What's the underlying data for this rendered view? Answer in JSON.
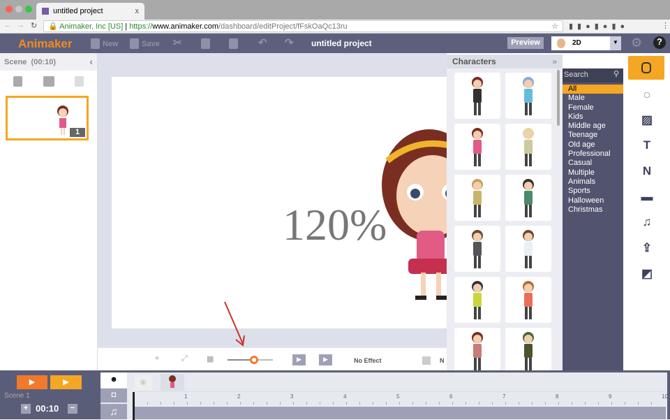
{
  "browser": {
    "tab_title": "untitled project",
    "tab_close": "x",
    "secure_label": "Animaker, Inc [US]",
    "url_prefix": "https://",
    "url_host": "www.animaker.com",
    "url_path": "/dashboard/editProject/fFskOaQc13ru"
  },
  "header": {
    "logo": "Animaker",
    "new_label": "New",
    "save_label": "Save",
    "project_title": "untitled project",
    "preview_label": "Preview",
    "mode_select": "2D"
  },
  "scene_panel": {
    "title": "Scene",
    "duration": "(00:10)",
    "scene_number": "1"
  },
  "canvas": {
    "zoom_overlay": "120%",
    "effect_label": "No Effect",
    "effect2_label": "N"
  },
  "characters": {
    "title": "Characters",
    "search_placeholder": "Search",
    "categories": [
      "All",
      "Male",
      "Female",
      "Kids",
      "Middle age",
      "Teenage",
      "Old age",
      "Professional",
      "Casual",
      "Multiple",
      "Animals",
      "Sports",
      "Halloween",
      "Christmas"
    ]
  },
  "timeline": {
    "scene_label": "Scene 1",
    "duration": "00:10",
    "ticks": [
      "1",
      "2",
      "3",
      "4",
      "5",
      "6",
      "7",
      "8",
      "9",
      "10"
    ]
  },
  "colors": {
    "accent": "#f5a623",
    "header": "#5d607c",
    "play_orange": "#f07a2a"
  }
}
